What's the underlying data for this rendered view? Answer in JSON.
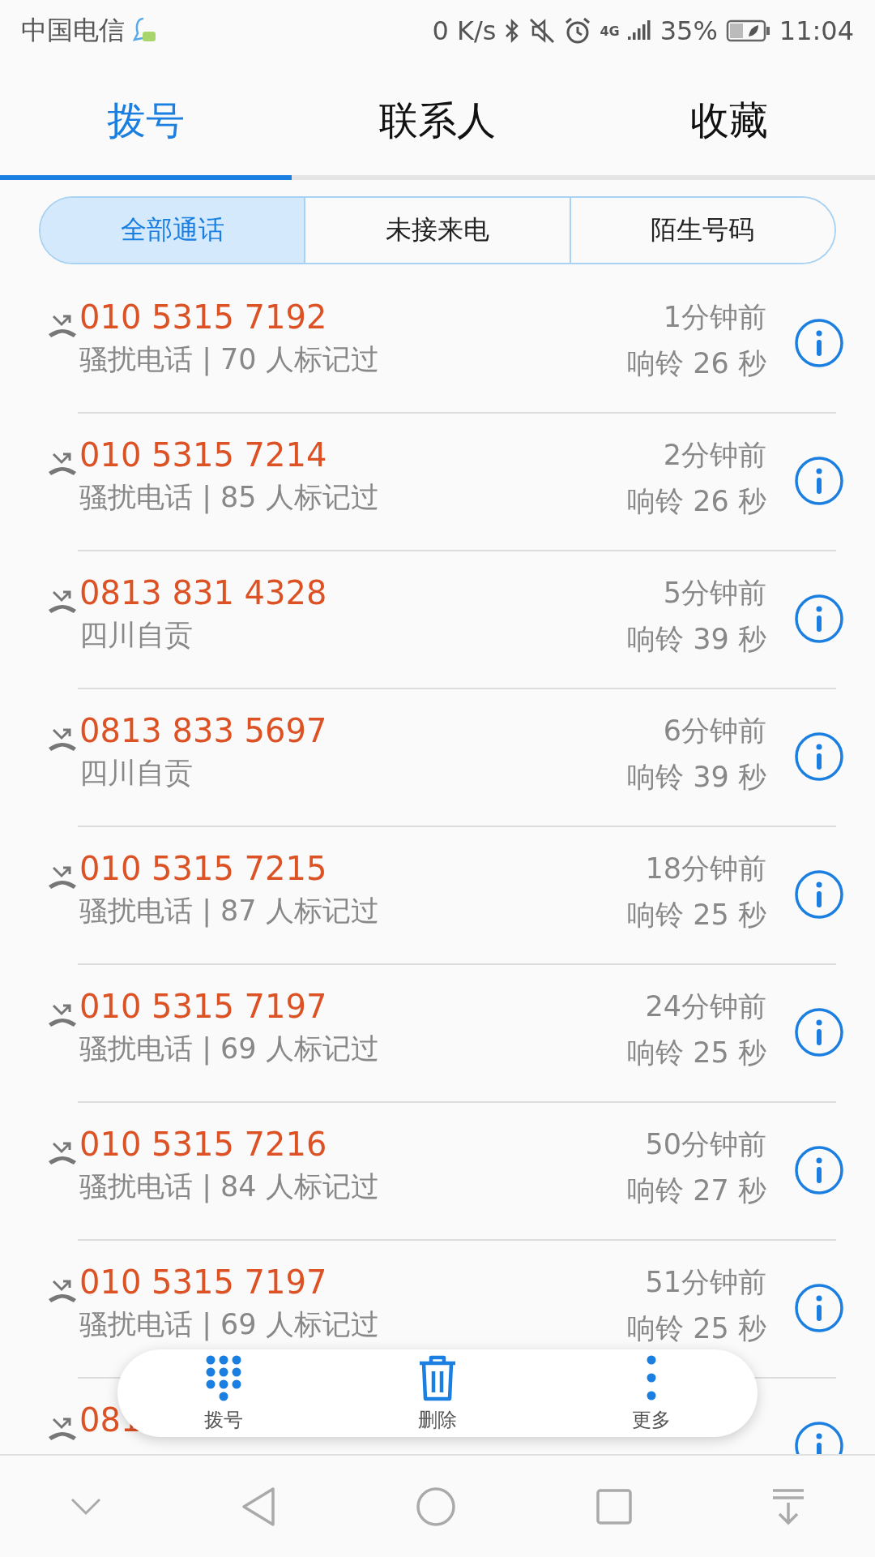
{
  "status_bar": {
    "carrier": "中国电信",
    "speed": "0 K/s",
    "network": "4G",
    "battery": "35%",
    "time": "11:04"
  },
  "tabs": [
    {
      "label": "拨号",
      "selected": true
    },
    {
      "label": "联系人",
      "selected": false
    },
    {
      "label": "收藏",
      "selected": false
    }
  ],
  "filters": [
    {
      "label": "全部通话",
      "selected": true
    },
    {
      "label": "未接来电",
      "selected": false
    },
    {
      "label": "陌生号码",
      "selected": false
    }
  ],
  "calls": [
    {
      "number": "010 5315 7192",
      "detail": "骚扰电话 | 70 人标记过",
      "time": "1分钟前",
      "ring": "响铃 26 秒"
    },
    {
      "number": "010 5315 7214",
      "detail": "骚扰电话 | 85 人标记过",
      "time": "2分钟前",
      "ring": "响铃 26 秒"
    },
    {
      "number": "0813 831 4328",
      "detail": "四川自贡",
      "time": "5分钟前",
      "ring": "响铃 39 秒"
    },
    {
      "number": "0813 833 5697",
      "detail": "四川自贡",
      "time": "6分钟前",
      "ring": "响铃 39 秒"
    },
    {
      "number": "010 5315 7215",
      "detail": "骚扰电话 | 87 人标记过",
      "time": "18分钟前",
      "ring": "响铃 25 秒"
    },
    {
      "number": "010 5315 7197",
      "detail": "骚扰电话 | 69 人标记过",
      "time": "24分钟前",
      "ring": "响铃 25 秒"
    },
    {
      "number": "010 5315 7216",
      "detail": "骚扰电话 | 84 人标记过",
      "time": "50分钟前",
      "ring": "响铃 27 秒"
    },
    {
      "number": "010 5315 7197",
      "detail": "骚扰电话 | 69 人标记过",
      "time": "51分钟前",
      "ring": "响铃 25 秒"
    },
    {
      "number": "081"
    }
  ],
  "actions": [
    {
      "kind": "dialpad",
      "label": "拨号"
    },
    {
      "kind": "delete",
      "label": "删除"
    },
    {
      "kind": "more",
      "label": "更多"
    }
  ]
}
